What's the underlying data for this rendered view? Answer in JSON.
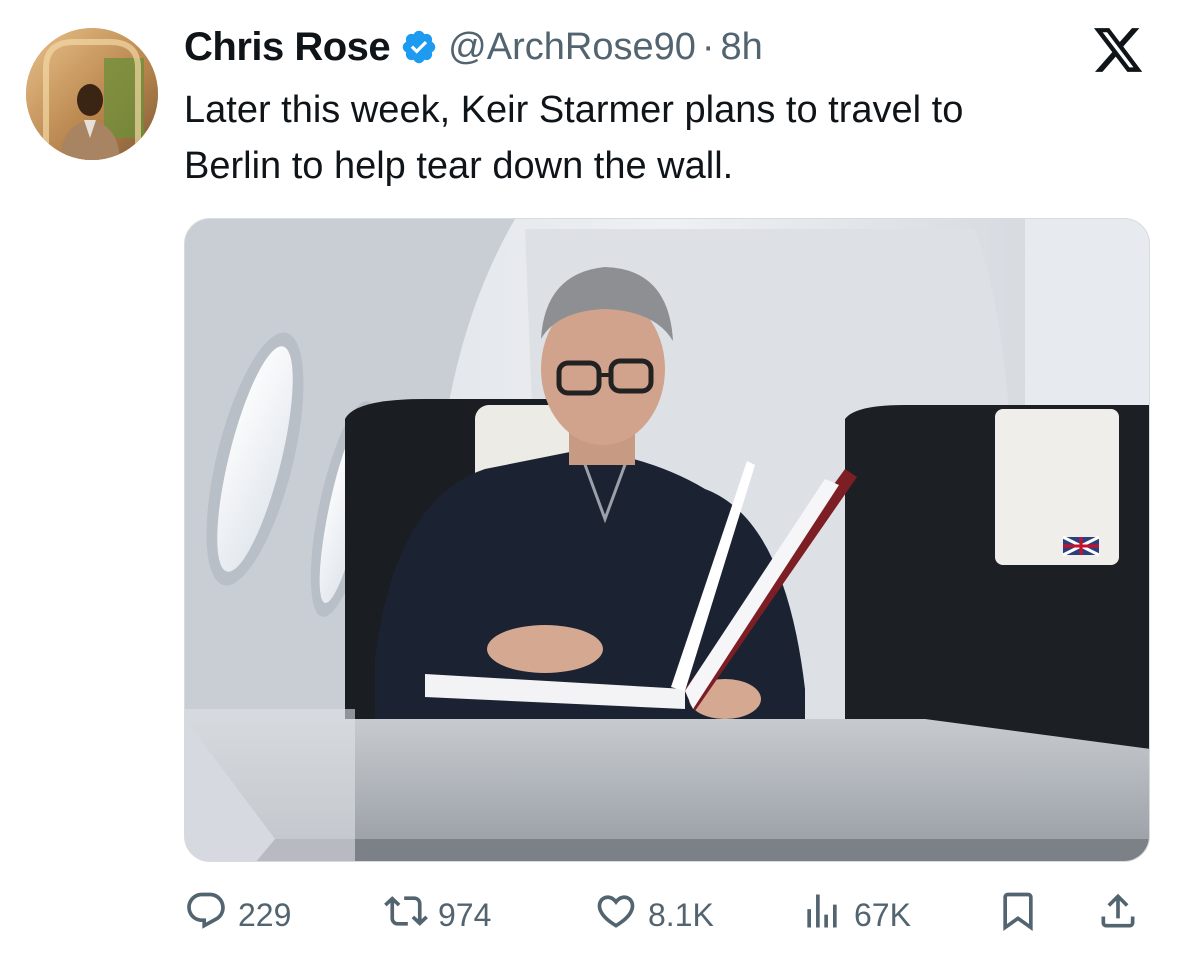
{
  "author": {
    "name": "Chris Rose",
    "handle": "@ArchRose90",
    "separator": "·",
    "time": "8h",
    "verified": true
  },
  "platform_icon": "x-logo-icon",
  "text": {
    "line1": "Later this week, Keir Starmer plans to travel to",
    "line2": "Berlin to help tear down the wall."
  },
  "actions": {
    "replies": "229",
    "reposts": "974",
    "likes": "8.1K",
    "views": "67K"
  },
  "icons": {
    "reply": "reply-icon",
    "repost": "repost-icon",
    "like": "heart-icon",
    "views": "views-chart-icon",
    "bookmark": "bookmark-icon",
    "share": "share-icon",
    "verified": "verified-badge-icon"
  },
  "colors": {
    "verified_blue": "#1d9bf0",
    "text_primary": "#0f1419",
    "text_secondary": "#536471"
  }
}
